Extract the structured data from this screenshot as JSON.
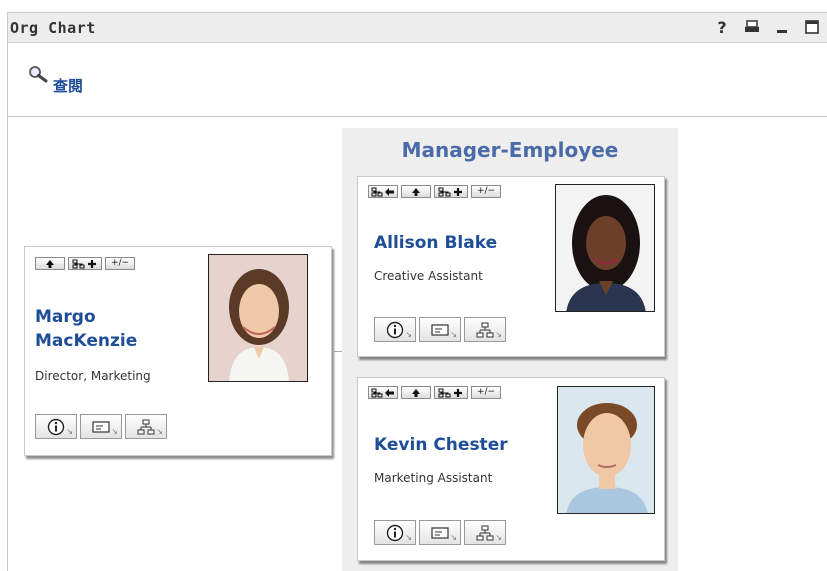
{
  "window": {
    "title": "Org Chart",
    "title_icons": [
      "help-icon",
      "print-icon",
      "minimize-icon",
      "maximize-icon"
    ],
    "help_label": "?"
  },
  "view": {
    "label": "查閱",
    "icon": "magnifier-icon"
  },
  "manager_employee": {
    "title": "Manager-Employee"
  },
  "people": [
    {
      "name_line1": "Margo",
      "name_line2": "MacKenzie",
      "role": "Director, Marketing"
    },
    {
      "name": "Allison Blake",
      "role": "Creative Assistant"
    },
    {
      "name": "Kevin Chester",
      "role": "Marketing Assistant"
    }
  ],
  "action_buttons": [
    "go-to-manager-icon",
    "up-arrow-icon",
    "add-org-icon",
    "expand-collapse-icon"
  ],
  "expand_label": "+/−",
  "card_buttons": [
    "info-icon",
    "email-icon",
    "org-chart-icon"
  ],
  "colors": {
    "link": "#1f4e99",
    "panel_title": "#4b6ba8",
    "panel_bg": "#eeeeee"
  }
}
